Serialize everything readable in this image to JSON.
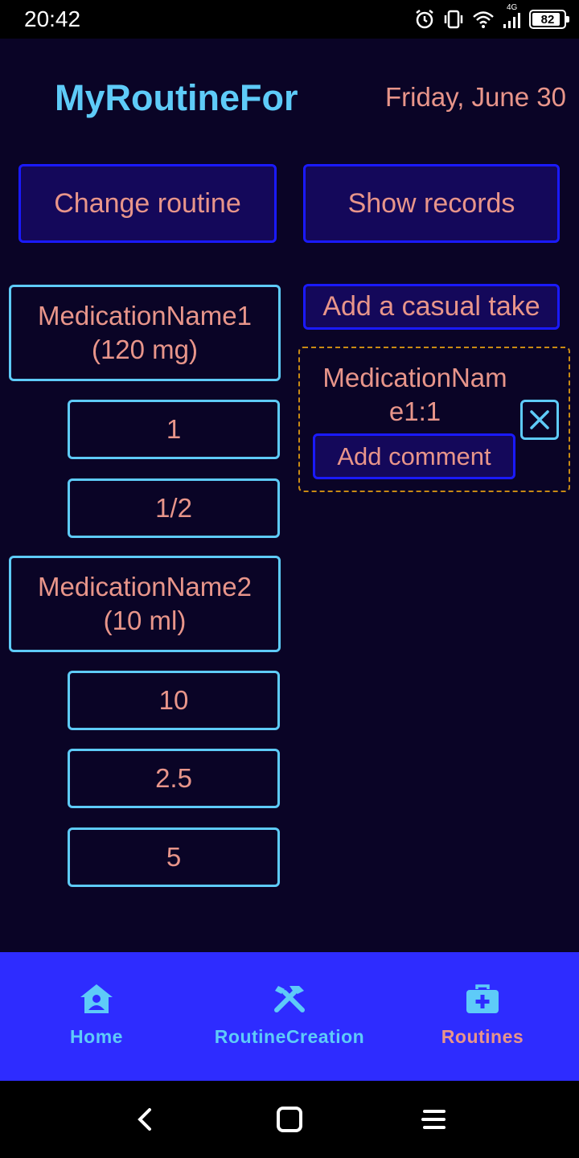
{
  "status_bar": {
    "time": "20:42",
    "network_label": "4G",
    "battery_level": "82"
  },
  "header": {
    "app_title": "MyRoutineFor",
    "date": "Friday, June 30"
  },
  "actions": {
    "change_routine": "Change routine",
    "show_records": "Show records",
    "add_casual_take": "Add a casual take"
  },
  "medications": [
    {
      "name": "MedicationName1",
      "amount": "(120 mg)",
      "doses": [
        "1",
        "1/2"
      ]
    },
    {
      "name": "MedicationName2",
      "amount": "(10 ml)",
      "doses": [
        "10",
        "2.5",
        "5"
      ]
    }
  ],
  "casual_take": {
    "name_line1": "MedicationNam",
    "name_line2": "e1:1",
    "add_comment": "Add comment",
    "remove_icon": "close-icon"
  },
  "bottom_nav": {
    "items": [
      {
        "label": "Home",
        "icon": "home-person-icon"
      },
      {
        "label": "RoutineCreation",
        "icon": "tools-icon"
      },
      {
        "label": "Routines",
        "icon": "medical-bag-icon"
      }
    ],
    "active_index": 2
  },
  "colors": {
    "background": "#0a0426",
    "accent_blue": "#5ecbf8",
    "text_salmon": "#e8958a",
    "nav_bar": "#2e2cff",
    "button_border": "#1a1aff"
  }
}
